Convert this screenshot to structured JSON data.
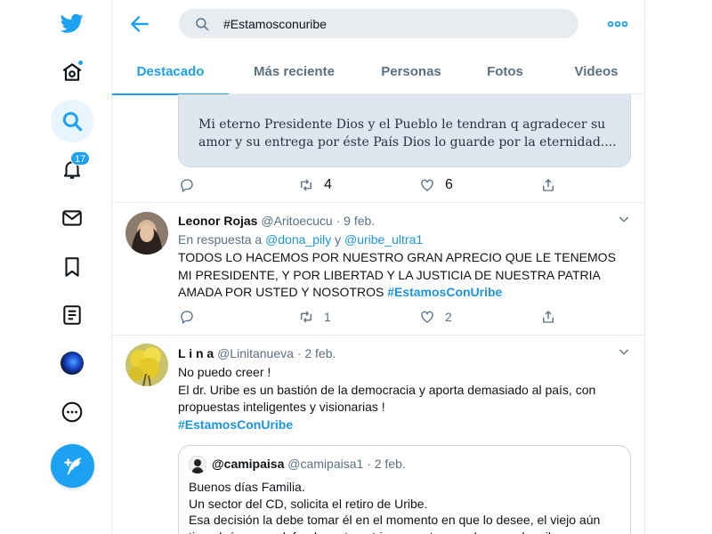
{
  "search": {
    "query": "#Estamosconuribe"
  },
  "notifications": {
    "count": "17"
  },
  "tabs": [
    "Destacado",
    "Más reciente",
    "Personas",
    "Fotos",
    "Videos"
  ],
  "tweet1": {
    "image_text": "Mi eterno Presidente Dios y el Pueblo le tendran q agradecer su amor y su entrega por éste País Dios lo guarde por la eternidad....",
    "retweets": "4",
    "likes": "6"
  },
  "tweet2": {
    "name": "Leonor Rojas",
    "handle": "@Aritoecucu",
    "date": "· 9 feb.",
    "reply_prefix": "En respuesta a",
    "reply_user1": "@dona_pily",
    "reply_and": "y",
    "reply_user2": "@uribe_ultra1",
    "text": "TODOS LO HACEMOS POR NUESTRO GRAN APRECIO QUE LE TENEMOS MI PRESIDENTE, Y POR LIBERTAD Y LA JUSTICIA DE NUESTRA PATRIA AMADA POR USTED Y NOSOTROS ",
    "hashtag": "#EstamosConUribe",
    "retweets": "1",
    "likes": "2"
  },
  "tweet3": {
    "name": "L i n a",
    "handle": "@Linitanueva",
    "date": "· 2 feb.",
    "line1": "No puedo creer !",
    "line2": "El dr. Uribe es un bastión de la democracia y aporta demasiado al país, con propuestas inteligentes y visionarias !",
    "hashtag": "#EstamosConUribe",
    "quote": {
      "name": "@camipaisa",
      "handle": "@camipaisa1",
      "date": "· 2 feb.",
      "line1": "Buenos días Familia.",
      "line2": "Un sector del CD, solicita el retiro de Uribe.",
      "line3": "Esa decisión la debe tomar él en el momento en que lo desee, el viejo aún tiene bríos para defender esta patria y cuenta con el apoyo de miles"
    }
  },
  "colors": {
    "accent": "#1da1f2",
    "link": "#1b95e0",
    "muted": "#5b7083",
    "border": "#e6ecf0"
  }
}
